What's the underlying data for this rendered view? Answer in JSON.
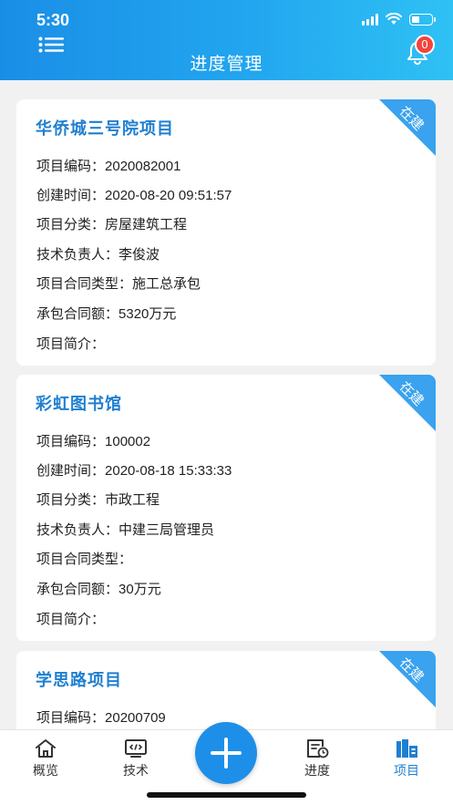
{
  "status_bar": {
    "time": "5:30"
  },
  "header": {
    "title": "进度管理",
    "notification_count": "0"
  },
  "projects": [
    {
      "name": "华侨城三号院项目",
      "status": "在建",
      "fields": [
        {
          "label": "项目编码：",
          "value": "2020082001"
        },
        {
          "label": "创建时间：",
          "value": "2020-08-20 09:51:57"
        },
        {
          "label": "项目分类：",
          "value": "房屋建筑工程"
        },
        {
          "label": "技术负责人：",
          "value": "李俊波"
        },
        {
          "label": "项目合同类型：",
          "value": "施工总承包"
        },
        {
          "label": "承包合同额：",
          "value": "5320万元"
        },
        {
          "label": "项目简介：",
          "value": ""
        }
      ]
    },
    {
      "name": "彩虹图书馆",
      "status": "在建",
      "fields": [
        {
          "label": "项目编码：",
          "value": "100002"
        },
        {
          "label": "创建时间：",
          "value": "2020-08-18 15:33:33"
        },
        {
          "label": "项目分类：",
          "value": "市政工程"
        },
        {
          "label": "技术负责人：",
          "value": "中建三局管理员"
        },
        {
          "label": "项目合同类型：",
          "value": ""
        },
        {
          "label": "承包合同额：",
          "value": "30万元"
        },
        {
          "label": "项目简介：",
          "value": ""
        }
      ]
    },
    {
      "name": "学思路项目",
      "status": "在建",
      "fields": [
        {
          "label": "项目编码：",
          "value": "20200709"
        }
      ]
    }
  ],
  "tabbar": {
    "tabs": [
      {
        "label": "概览",
        "icon": "home-icon"
      },
      {
        "label": "技术",
        "icon": "code-icon"
      },
      {
        "label": "进度",
        "icon": "schedule-icon"
      },
      {
        "label": "项目",
        "icon": "building-icon"
      }
    ],
    "active": "项目",
    "add_icon": "plus-icon"
  },
  "colors": {
    "accent": "#1f7fd0",
    "header_start": "#1a8ee6",
    "header_end": "#2fc1f4",
    "ribbon": "#3aa2ee",
    "badge": "#f2453d"
  }
}
